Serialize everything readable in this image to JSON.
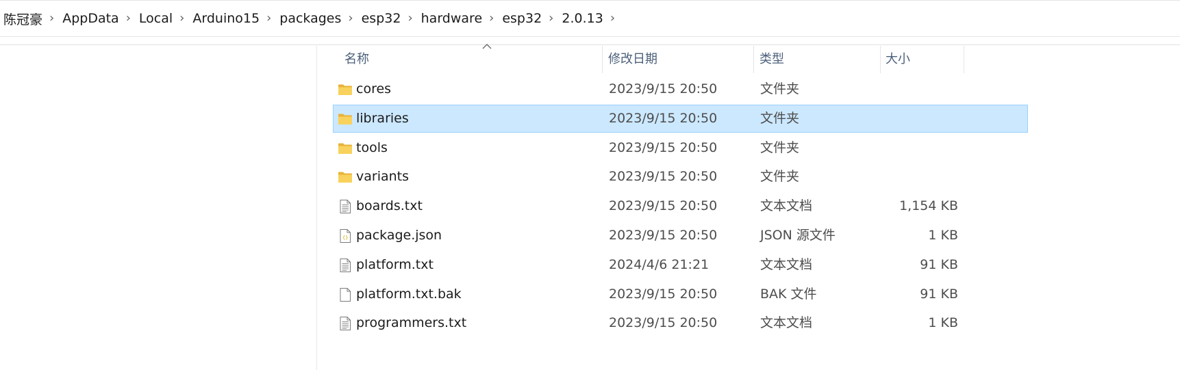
{
  "breadcrumb": [
    {
      "label": "陈冠豪"
    },
    {
      "label": "AppData"
    },
    {
      "label": "Local"
    },
    {
      "label": "Arduino15"
    },
    {
      "label": "packages"
    },
    {
      "label": "esp32"
    },
    {
      "label": "hardware"
    },
    {
      "label": "esp32"
    },
    {
      "label": "2.0.13"
    }
  ],
  "columns": {
    "name": "名称",
    "date": "修改日期",
    "type": "类型",
    "size": "大小"
  },
  "files": [
    {
      "name": "cores",
      "date": "2023/9/15 20:50",
      "type": "文件夹",
      "size": "",
      "icon": "folder-icon"
    },
    {
      "name": "libraries",
      "date": "2023/9/15 20:50",
      "type": "文件夹",
      "size": "",
      "icon": "folder-icon",
      "selected": true
    },
    {
      "name": "tools",
      "date": "2023/9/15 20:50",
      "type": "文件夹",
      "size": "",
      "icon": "folder-icon"
    },
    {
      "name": "variants",
      "date": "2023/9/15 20:50",
      "type": "文件夹",
      "size": "",
      "icon": "folder-icon"
    },
    {
      "name": "boards.txt",
      "date": "2023/9/15 20:50",
      "type": "文本文档",
      "size": "1,154 KB",
      "icon": "text-file-icon"
    },
    {
      "name": "package.json",
      "date": "2023/9/15 20:50",
      "type": "JSON 源文件",
      "size": "1 KB",
      "icon": "json-file-icon"
    },
    {
      "name": "platform.txt",
      "date": "2024/4/6 21:21",
      "type": "文本文档",
      "size": "91 KB",
      "icon": "text-file-icon"
    },
    {
      "name": "platform.txt.bak",
      "date": "2023/9/15 20:50",
      "type": "BAK 文件",
      "size": "91 KB",
      "icon": "blank-file-icon"
    },
    {
      "name": "programmers.txt",
      "date": "2023/9/15 20:50",
      "type": "文本文档",
      "size": "1 KB",
      "icon": "text-file-icon"
    }
  ],
  "colors": {
    "selection_bg": "#cce8ff",
    "selection_border": "#99d1ff",
    "folder": "#f8d25c",
    "header_text": "#4c607a"
  }
}
